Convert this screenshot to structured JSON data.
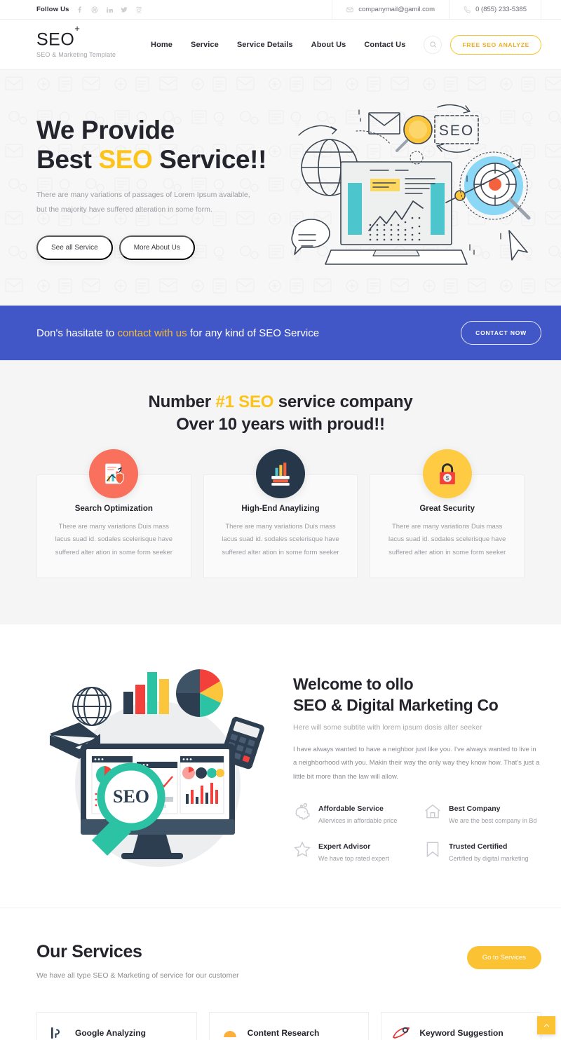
{
  "topbar": {
    "follow_label": "Follow Us",
    "socials": [
      {
        "name": "facebook-icon"
      },
      {
        "name": "dribbble-icon"
      },
      {
        "name": "linkedin-icon"
      },
      {
        "name": "twitter-icon"
      },
      {
        "name": "instagram-icon"
      }
    ],
    "email": "companymail@gamil.com",
    "phone": "0 (855) 233-5385"
  },
  "nav": {
    "brand": "SEO",
    "brand_sup": "+",
    "tagline": "SEO & Marketing Template",
    "menu": [
      "Home",
      "Service",
      "Service Details",
      "About Us",
      "Contact Us"
    ],
    "cta_label": "FREE SEO ANALYZE"
  },
  "hero": {
    "title_line1": "We Provide",
    "title_line2_pre": "Best ",
    "title_line2_hl": "SEO",
    "title_line2_post": " Service!!",
    "sub_line1": "There are many variations of passages of Lorem Ipsum available,",
    "sub_line2": "but the majority have suffered alteration in some form.",
    "btn_primary": "See all Service",
    "btn_secondary": "More About Us",
    "illustration_label": "SEO"
  },
  "banner": {
    "text_pre": "Don's hasitate to ",
    "text_accent": "contact with us",
    "text_post": " for any kind of SEO Service",
    "button": "CONTACT NOW"
  },
  "features": {
    "heading_pre": "Number ",
    "heading_hl": "#1 SEO",
    "heading_post": " service company",
    "heading_line2": "Over 10 years with proud!!",
    "cards": [
      {
        "title": "Search Optimization",
        "text": "There are many variations Duis mass lacus suad id. sodales scelerisque have suffered alter ation in some form seeker",
        "icon": "search-optimization-icon",
        "bg": "#f9705c"
      },
      {
        "title": "High-End Anaylizing",
        "text": "There are many variations Duis mass lacus suad id. sodales scelerisque have suffered alter ation in some form seeker",
        "icon": "analytics-books-icon",
        "bg": "#263749"
      },
      {
        "title": "Great Security",
        "text": "There are many variations Duis mass lacus suad id. sodales scelerisque have suffered alter ation in some form seeker",
        "icon": "lock-security-icon",
        "bg": "#fecb43"
      }
    ]
  },
  "welcome": {
    "title_line1": "Welcome to ollo",
    "title_line2": "SEO & Digital Marketing Co",
    "subtitle": "Here will some subtite with lorem ipsum dosis alter seeker",
    "body": "I have always wanted to have a neighbor just like you. I've always wanted to live in a neighborhood with you. Makin their way the only way they know how. That's just a little bit more than the law will allow.",
    "illustration_label": "SEO",
    "items": [
      {
        "title": "Affordable Service",
        "desc": "Allervices in affordable price",
        "icon": "piggy-bank-icon"
      },
      {
        "title": "Best Company",
        "desc": "We are the best company in Bd",
        "icon": "home-icon"
      },
      {
        "title": "Expert Advisor",
        "desc": "We have top rated expert",
        "icon": "star-icon"
      },
      {
        "title": "Trusted Certified",
        "desc": "Certified by digital marketing",
        "icon": "bookmark-icon"
      }
    ]
  },
  "services": {
    "title": "Our Services",
    "subtitle": "We have all type SEO & Marketing of service for our customer",
    "button": "Go to Services",
    "cards": [
      {
        "title": "Google Analyzing",
        "icon": "google-analytics-icon"
      },
      {
        "title": "Content Research",
        "icon": "content-research-icon"
      },
      {
        "title": "Keyword Suggestion",
        "icon": "keyword-suggestion-icon"
      }
    ]
  },
  "scroll_top": {
    "icon": "chevron-up-icon"
  },
  "colors": {
    "accent_yellow": "#fcc31a",
    "banner_blue": "#4257c7",
    "button_yellow": "#fbc334",
    "dark": "#24242c",
    "muted": "#9b9ba2"
  }
}
